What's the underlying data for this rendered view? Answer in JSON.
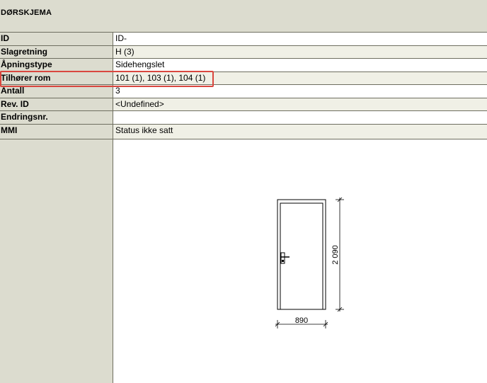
{
  "header": {
    "title": "DØRSKJEMA"
  },
  "properties": [
    {
      "label": "ID",
      "value": "ID-"
    },
    {
      "label": "Slagretning",
      "value": "H (3)"
    },
    {
      "label": "Åpningstype",
      "value": "Sidehengslet"
    },
    {
      "label": "Tilhører rom",
      "value": "101 (1), 103 (1), 104 (1)"
    },
    {
      "label": "Antall",
      "value": "3"
    },
    {
      "label": "Rev. ID",
      "value": "<Undefined>"
    },
    {
      "label": "Endringsnr.",
      "value": ""
    },
    {
      "label": "MMI",
      "value": "Status ikke satt"
    }
  ],
  "drawing": {
    "width_label": "890",
    "height_label": "2 090"
  },
  "colors": {
    "panel": "#dcdccf",
    "shaded_cell": "#f0f0e6",
    "border": "#6e6e60",
    "highlight": "#d9473f"
  }
}
